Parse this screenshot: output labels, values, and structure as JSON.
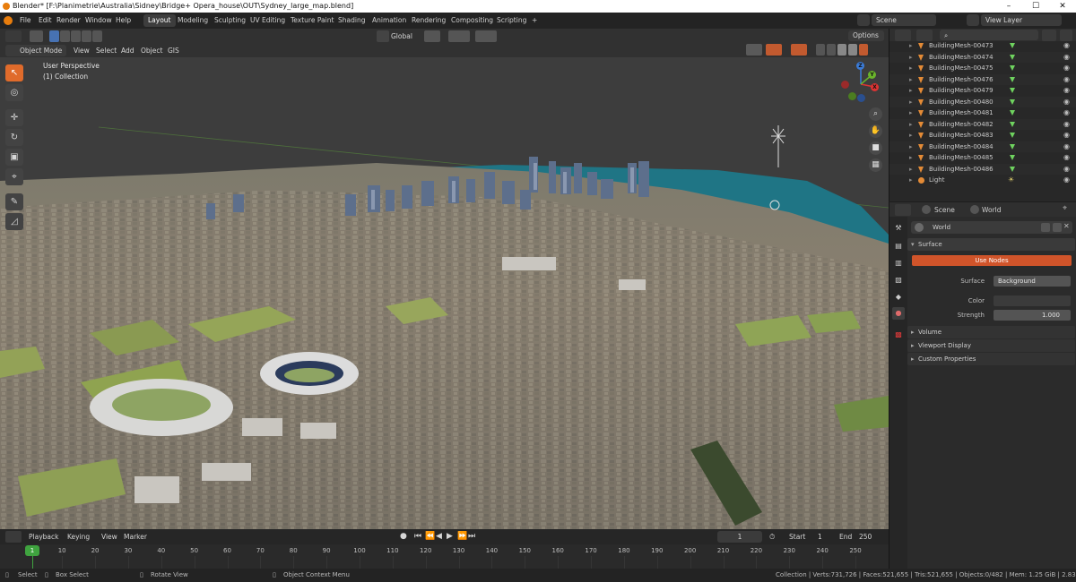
{
  "window": {
    "title": "Blender* [F:\\Planimetrie\\Australia\\Sidney\\Bridge+ Opera_house\\OUT\\Sydney_large_map.blend]",
    "minimize": "–",
    "maximize": "☐",
    "close": "✕"
  },
  "menu": [
    "File",
    "Edit",
    "Render",
    "Window",
    "Help"
  ],
  "workspaces": [
    "Layout",
    "Modeling",
    "Sculpting",
    "UV Editing",
    "Texture Paint",
    "Shading",
    "Animation",
    "Rendering",
    "Compositing",
    "Scripting"
  ],
  "add_workspace": "+",
  "scene_field": "Scene",
  "view_layer_field": "View Layer",
  "viewport": {
    "mode": "Object Mode",
    "menus": [
      "View",
      "Select",
      "Add",
      "Object",
      "GIS"
    ],
    "transform_orientation": "Global",
    "options": "Options",
    "overlay_line1": "User Perspective",
    "overlay_line2": "(1) Collection",
    "gizmo": {
      "x": "X",
      "y": "Y",
      "z": "Z"
    }
  },
  "tools": [
    "select-box",
    "cursor",
    "move",
    "rotate",
    "scale",
    "transform",
    "annotate",
    "measure"
  ],
  "outliner": {
    "rows": [
      {
        "name": "BuildingMesh-00473",
        "type": "mesh"
      },
      {
        "name": "BuildingMesh-00474",
        "type": "mesh"
      },
      {
        "name": "BuildingMesh-00475",
        "type": "mesh"
      },
      {
        "name": "BuildingMesh-00476",
        "type": "mesh"
      },
      {
        "name": "BuildingMesh-00479",
        "type": "mesh"
      },
      {
        "name": "BuildingMesh-00480",
        "type": "mesh"
      },
      {
        "name": "BuildingMesh-00481",
        "type": "mesh"
      },
      {
        "name": "BuildingMesh-00482",
        "type": "mesh"
      },
      {
        "name": "BuildingMesh-00483",
        "type": "mesh"
      },
      {
        "name": "BuildingMesh-00484",
        "type": "mesh"
      },
      {
        "name": "BuildingMesh-00485",
        "type": "mesh"
      },
      {
        "name": "BuildingMesh-00486",
        "type": "mesh"
      },
      {
        "name": "Light",
        "type": "light"
      }
    ]
  },
  "properties": {
    "breadcrumb_scene": "Scene",
    "breadcrumb_world": "World",
    "world_name": "World",
    "surface_panel": "Surface",
    "use_nodes": "Use Nodes",
    "surface_label": "Surface",
    "surface_value": "Background",
    "color_label": "Color",
    "strength_label": "Strength",
    "strength_value": "1.000",
    "collapsed_panels": [
      "Volume",
      "Viewport Display",
      "Custom Properties"
    ]
  },
  "timeline": {
    "menus": [
      "Playback",
      "Keying",
      "View",
      "Marker"
    ],
    "current_frame": "1",
    "start_label": "Start",
    "start_value": "1",
    "end_label": "End",
    "end_value": "250",
    "ticks": [
      "1",
      "10",
      "20",
      "30",
      "40",
      "50",
      "60",
      "70",
      "80",
      "90",
      "100",
      "110",
      "120",
      "130",
      "140",
      "150",
      "160",
      "170",
      "180",
      "190",
      "200",
      "210",
      "220",
      "230",
      "240",
      "250"
    ]
  },
  "statusbar": {
    "select": "Select",
    "box_select": "Box Select",
    "rotate_view": "Rotate View",
    "context_menu": "Object Context Menu",
    "stats": "Collection | Verts:731,726 | Faces:521,655 | Tris:521,655 | Objects:0/482 | Mem: 1.25 GiB | 2.83.3"
  },
  "colors": {
    "accent_orange": "#e06b2b",
    "selection_blue": "#4772b3",
    "use_nodes_button": "#d0542a",
    "timeline_playhead": "#3fa33f"
  }
}
